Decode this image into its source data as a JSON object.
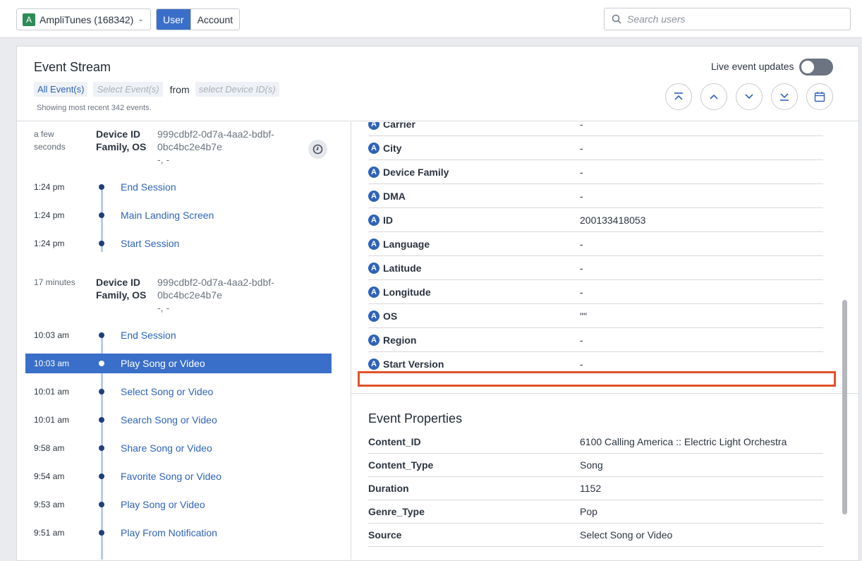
{
  "topbar": {
    "project_badge": "A",
    "project_name": "AmpliTunes (168342)",
    "segments": [
      "User",
      "Account"
    ],
    "search_placeholder": "Search users"
  },
  "stream": {
    "title": "Event Stream",
    "all_events": "All Event(s)",
    "select_events": "Select Event(s)",
    "from": "from",
    "select_device": "select Device ID(s)",
    "count_text": "Showing most recent 342 events.",
    "live_label": "Live event updates"
  },
  "sessions": [
    {
      "ago": "a few seconds",
      "device_label": "Device ID Family, OS",
      "device_id": "999cdbf2-0d7a-4aa2-bdbf-0bc4bc2e4b7e",
      "device_extra": "-, -"
    },
    {
      "ago": "17 minutes",
      "device_label": "Device ID Family, OS",
      "device_id": "999cdbf2-0d7a-4aa2-bdbf-0bc4bc2e4b7e",
      "device_extra": "-, -"
    }
  ],
  "events_a": [
    {
      "time": "1:24 pm",
      "name": "End Session"
    },
    {
      "time": "1:24 pm",
      "name": "Main Landing Screen"
    },
    {
      "time": "1:24 pm",
      "name": "Start Session"
    }
  ],
  "events_b": [
    {
      "time": "10:03 am",
      "name": "End Session"
    },
    {
      "time": "10:03 am",
      "name": "Play Song or Video"
    },
    {
      "time": "10:01 am",
      "name": "Select Song or Video"
    },
    {
      "time": "10:01 am",
      "name": "Search Song or Video"
    },
    {
      "time": "9:58 am",
      "name": "Share Song or Video"
    },
    {
      "time": "9:54 am",
      "name": "Favorite Song or Video"
    },
    {
      "time": "9:53 am",
      "name": "Play Song or Video"
    },
    {
      "time": "9:51 am",
      "name": "Play From Notification"
    }
  ],
  "user_props": [
    {
      "key": "Carrier",
      "value": "-"
    },
    {
      "key": "City",
      "value": "-"
    },
    {
      "key": "Device Family",
      "value": "-"
    },
    {
      "key": "DMA",
      "value": "-"
    },
    {
      "key": "ID",
      "value": "200133418053"
    },
    {
      "key": "Language",
      "value": "-"
    },
    {
      "key": "Latitude",
      "value": "-"
    },
    {
      "key": "Longitude",
      "value": "-"
    },
    {
      "key": "OS",
      "value": "\"\""
    },
    {
      "key": "Region",
      "value": "-"
    },
    {
      "key": "Start Version",
      "value": "-"
    }
  ],
  "event_props_title": "Event Properties",
  "event_props": [
    {
      "key": "Content_ID",
      "value": "6100 Calling America :: Electric Light Orchestra"
    },
    {
      "key": "Content_Type",
      "value": "Song"
    },
    {
      "key": "Duration",
      "value": "1152"
    },
    {
      "key": "Genre_Type",
      "value": "Pop"
    },
    {
      "key": "Source",
      "value": "Select Song or Video"
    }
  ],
  "prop_icon_letter": "A",
  "colors": {
    "accent": "#3a6fc9",
    "link": "#2f63b8",
    "highlight": "#e0522a"
  }
}
